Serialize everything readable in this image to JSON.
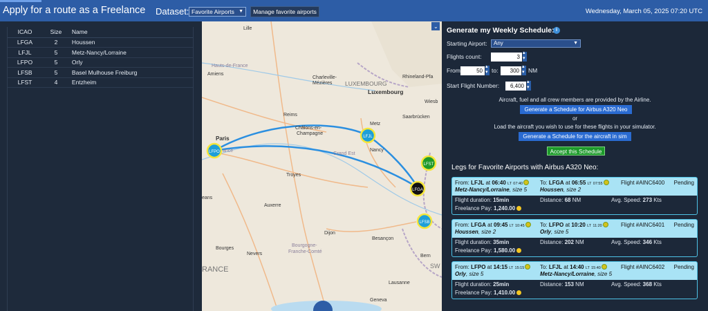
{
  "app": {
    "title": "Apply for a route as a Freelance",
    "datetime": "Wednesday, March 05, 2025 07:20 UTC"
  },
  "dataset": {
    "label": "Dataset:",
    "value": "Favorite Airports",
    "manage_label": "Manage favorite airports"
  },
  "airports_table": {
    "headers": [
      "ICAO",
      "Size",
      "Name"
    ],
    "rows": [
      {
        "icao": "LFGA",
        "size": "2",
        "name": "Houssen"
      },
      {
        "icao": "LFJL",
        "size": "5",
        "name": "Metz-Nancy/Lorraine"
      },
      {
        "icao": "LFPO",
        "size": "5",
        "name": "Orly"
      },
      {
        "icao": "LFSB",
        "size": "5",
        "name": "Basel Mulhouse Freiburg"
      },
      {
        "icao": "LFST",
        "size": "4",
        "name": "Entzheim"
      }
    ]
  },
  "map": {
    "labels": {
      "lille": "Lille",
      "amiens": "Amiens",
      "hauts_de_france": "Hauts-de-France",
      "charleville": "Charleville-",
      "mezieres": "Mézières",
      "luxembourg_region": "LUXEMBOURG",
      "luxembourg": "Luxembourg",
      "rhineland": "Rhineland-Pfa",
      "wiesb": "Wiesb",
      "saarbrucken": "Saarbrücken",
      "metz": "Metz",
      "nancy": "Nancy",
      "grand_est": "Grand Est",
      "reims": "Reims",
      "chalons": "Châlons-en-",
      "champagne": "Champagne",
      "paris": "Paris",
      "troyes": "Troyes",
      "auxerre": "Auxerre",
      "dijon": "Dijon",
      "besancon": "Besançon",
      "bourges": "Bourges",
      "nevers": "Nevers",
      "bourgogne": "Bourgogne-",
      "franche_comte": "Franche-Comté",
      "bern": "Bern",
      "lausanne": "Lausanne",
      "geneva": "Geneva",
      "france": "RANCE",
      "orleans": "eans",
      "sw": "SW",
      "ance": "ance"
    },
    "markers": [
      {
        "code": "LFPO",
        "color": "#1e9fd8"
      },
      {
        "code": "LFJL",
        "color": "#1e9fd8"
      },
      {
        "code": "LFGA",
        "color": "#111111"
      },
      {
        "code": "LFST",
        "color": "#1f9a2a"
      },
      {
        "code": "LFSB",
        "color": "#1e9fd8"
      }
    ],
    "route_color": "#2b8fe0"
  },
  "schedule": {
    "title": "Generate my Weekly Schedule:",
    "info_icon": "i",
    "starting_airport_label": "Starting Airport:",
    "starting_airport_value": "Any",
    "flights_count_label": "Flights count:",
    "flights_count": "3",
    "from_label": "From:",
    "from_value": "50",
    "to_label": "to:",
    "to_value": "300",
    "nm_label": "NM",
    "start_flight_label": "Start Flight Number:",
    "start_flight_value": "6,400",
    "provided_text": "Aircraft, fuel and all crew members are provided by the Airline.",
    "generate_neo_button": "Generate a Schedule for Airbus A320 Neo",
    "or_text": "or",
    "load_text": "Load the aircraft you wish to use for these flights in your simulator.",
    "generate_sim_button": "Generate a Schedule for the aircraft in sim",
    "accept_button": "Accept this Schedule"
  },
  "legs_title": "Legs for Favorite Airports with Airbus A320 Neo:",
  "legs": [
    {
      "from_prefix": "From: ",
      "from": "LFJL",
      "at": " at ",
      "dep": "06:40",
      "lt": "LT",
      "dep_lt": "07:40",
      "from_name": "Metz-Nancy/Lorraine",
      "from_size": ", size 5",
      "to_prefix": "To: ",
      "to": "LFGA",
      "arr": "06:55",
      "arr_lt": "07:55",
      "to_name": "Houssen",
      "to_size": ", size 2",
      "flight": "Flight #AINC6400",
      "status": "Pending",
      "duration_label": "Flight duration: ",
      "duration": "15min",
      "distance_label": "Distance: ",
      "distance": "68",
      "nm": " NM",
      "speed_label": "Avg. Speed: ",
      "speed": "273",
      "kts": " Kts",
      "pay_label": "Freelance Pay: ",
      "pay": "1,240.00"
    },
    {
      "from_prefix": "From: ",
      "from": "LFGA",
      "at": " at ",
      "dep": "09:45",
      "lt": "LT",
      "dep_lt": "10:45",
      "from_name": "Houssen",
      "from_size": ", size 2",
      "to_prefix": "To: ",
      "to": "LFPO",
      "arr": "10:20",
      "arr_lt": "11:20",
      "to_name": "Orly",
      "to_size": ", size 5",
      "flight": "Flight #AINC6401",
      "status": "Pending",
      "duration_label": "Flight duration: ",
      "duration": "35min",
      "distance_label": "Distance: ",
      "distance": "202",
      "nm": " NM",
      "speed_label": "Avg. Speed: ",
      "speed": "346",
      "kts": " Kts",
      "pay_label": "Freelance Pay: ",
      "pay": "1,580.00"
    },
    {
      "from_prefix": "From: ",
      "from": "LFPO",
      "at": " at ",
      "dep": "14:15",
      "lt": "LT",
      "dep_lt": "15:15",
      "from_name": "Orly",
      "from_size": ", size 5",
      "to_prefix": "To: ",
      "to": "LFJL",
      "arr": "14:40",
      "arr_lt": "15:40",
      "to_name": "Metz-Nancy/Lorraine",
      "to_size": ", size 5",
      "flight": "Flight #AINC6402",
      "status": "Pending",
      "duration_label": "Flight duration: ",
      "duration": "25min",
      "distance_label": "Distance: ",
      "distance": "153",
      "nm": " NM",
      "speed_label": "Avg. Speed: ",
      "speed": "368",
      "kts": " Kts",
      "pay_label": "Freelance Pay: ",
      "pay": "1,410.00"
    }
  ]
}
